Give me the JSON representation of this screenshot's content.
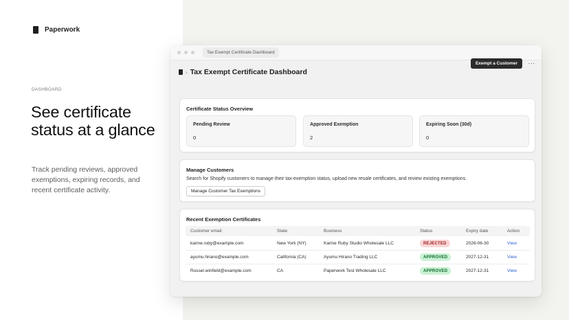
{
  "brand": {
    "name": "Paperwork"
  },
  "hero": {
    "eyebrow": "DASHBOARD",
    "headline": "See certificate status at a glance",
    "subtext": "Track pending reviews, approved exemptions, expiring records, and recent certificate activity."
  },
  "window": {
    "tab_title": "Tax Exempt Certificate Dashboard"
  },
  "appbar": {
    "title": "Tax Exempt Certificate Dashboard",
    "primary_button": "Exempt a Customer",
    "more_label": "···"
  },
  "overview": {
    "title": "Certificate Status Overview",
    "stats": [
      {
        "label": "Pending Review",
        "value": "0"
      },
      {
        "label": "Approved Exemption",
        "value": "2"
      },
      {
        "label": "Expiring Soon (30d)",
        "value": "0"
      }
    ]
  },
  "manage": {
    "title": "Manage Customers",
    "description": "Search for Shopify customers to manage their tax-exemption status, upload new resale certificates, and review existing exemptions.",
    "button": "Manage Customer Tax Exemptions"
  },
  "recent": {
    "title": "Recent Exemption Certificates",
    "columns": [
      "Customer email",
      "State",
      "Business",
      "Status",
      "Expiry date",
      "Action"
    ],
    "rows": [
      {
        "email": "karine.ruby@example.com",
        "state": "New York (NY)",
        "business": "Karine Ruby Studio Wholesale LLC",
        "status": "REJECTED",
        "expiry": "2026-06-30",
        "action": "View"
      },
      {
        "email": "ayumu.hirano@example.com",
        "state": "California (CA)",
        "business": "Ayumu Hirano Trading LLC",
        "status": "APPROVED",
        "expiry": "2027-12-31",
        "action": "View"
      },
      {
        "email": "Russel.winfield@example.com",
        "state": "CA",
        "business": "Paperwork Test Wholesale LLC",
        "status": "APPROVED",
        "expiry": "2027-12-31",
        "action": "View"
      }
    ]
  },
  "colors": {
    "rejected_bg": "#fbd6d6",
    "approved_bg": "#c9f2d4",
    "link": "#2d5fd6",
    "primary_button_bg": "#2b2b2b"
  }
}
